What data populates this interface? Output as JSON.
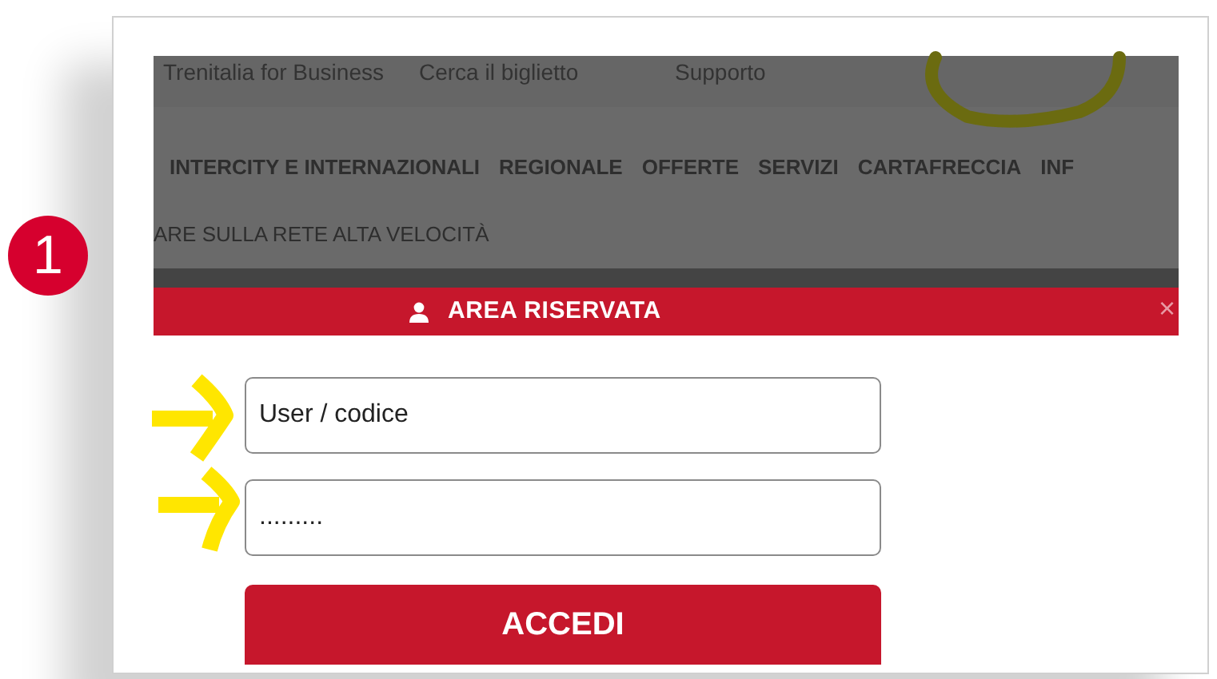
{
  "step_badge": "1",
  "top_links": [
    "Trenitalia for Business",
    "Cerca il biglietto",
    "Supporto"
  ],
  "menu": [
    "INTERCITY E INTERNAZIONALI",
    "REGIONALE",
    "OFFERTE",
    "SERVIZI",
    "CARTAFRECCIA",
    "INF"
  ],
  "banner": "ARE SULLA RETE ALTA VELOCITÀ",
  "dialog": {
    "title": "AREA RISERVATA",
    "close": "×",
    "fields": [
      {
        "value": "User / codice"
      },
      {
        "value": "........."
      }
    ],
    "button": "ACCEDI"
  }
}
